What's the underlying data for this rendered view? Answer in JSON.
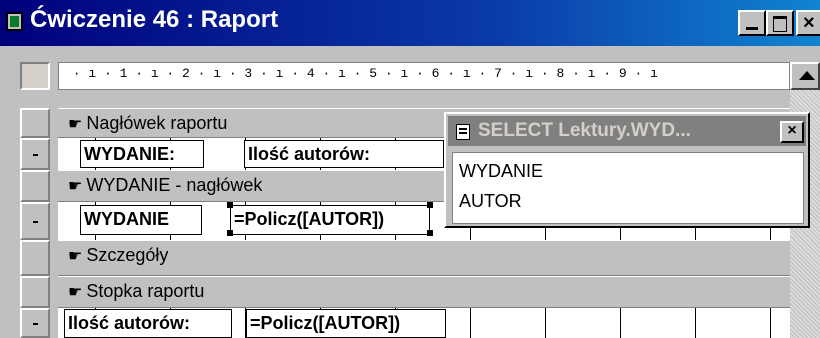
{
  "window": {
    "title": "Ćwiczenie 46 : Raport",
    "close_glyph": "×"
  },
  "ruler": {
    "marks": " · ı · 1 · ı · 2 · ı · 3 · ı · 4 · ı · 5 · ı · 6 · ı · 7 · ı · 8 · ı · 9 · ı"
  },
  "bands": {
    "report_header": "Nagłówek raportu",
    "group_header": "WYDANIE - nagłówek",
    "detail": "Szczegóły",
    "report_footer": "Stopka raportu",
    "hand_glyph": "☛"
  },
  "controls": {
    "report_header_label_1": "WYDANIE:",
    "report_header_label_2": "Ilość autorów:",
    "group_field": "WYDANIE",
    "group_expression": "=Policz([AUTOR])",
    "footer_label": "Ilość autorów:",
    "footer_expression": "=Policz([AUTOR])"
  },
  "field_list": {
    "title": "SELECT Lektury.WYD...",
    "close_glyph": "×",
    "fields": [
      "WYDANIE",
      "AUTOR"
    ]
  }
}
